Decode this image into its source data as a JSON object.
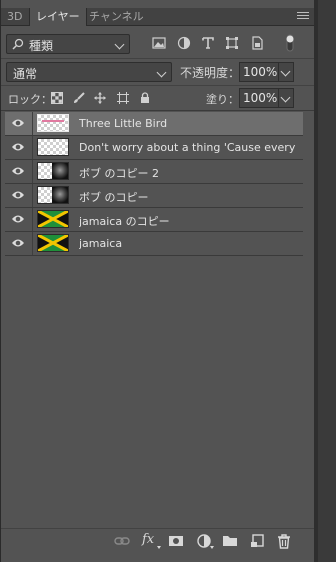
{
  "tabs": [
    {
      "label": "3D"
    },
    {
      "label": "レイヤー"
    },
    {
      "label": "チャンネル"
    }
  ],
  "filter": {
    "kind_label": "種類"
  },
  "blend": {
    "mode": "通常",
    "opacity_label": "不透明度：",
    "opacity_value": "100%"
  },
  "lock": {
    "label": "ロック：",
    "fill_label": "塗り：",
    "fill_value": "100%"
  },
  "layers": [
    {
      "name": "Three Little Bird",
      "selected": true,
      "thumb": "text"
    },
    {
      "name": "Don't worry about a thing 'Cause every ...",
      "selected": false,
      "thumb": "text"
    },
    {
      "name": "ボブ のコピー 2",
      "selected": false,
      "thumb": "photo"
    },
    {
      "name": "ボブ のコピー",
      "selected": false,
      "thumb": "photo"
    },
    {
      "name": "jamaica のコピー",
      "selected": false,
      "thumb": "flag"
    },
    {
      "name": "jamaica",
      "selected": false,
      "thumb": "flag"
    }
  ],
  "bottom_toolbar": {
    "fx_label": "fx"
  },
  "colors": {
    "panel_bg": "#535353",
    "selected_row": "#6e6e6e",
    "flag_green": "#1f8f3a",
    "flag_yellow": "#f2c500",
    "flag_black": "#111111"
  }
}
